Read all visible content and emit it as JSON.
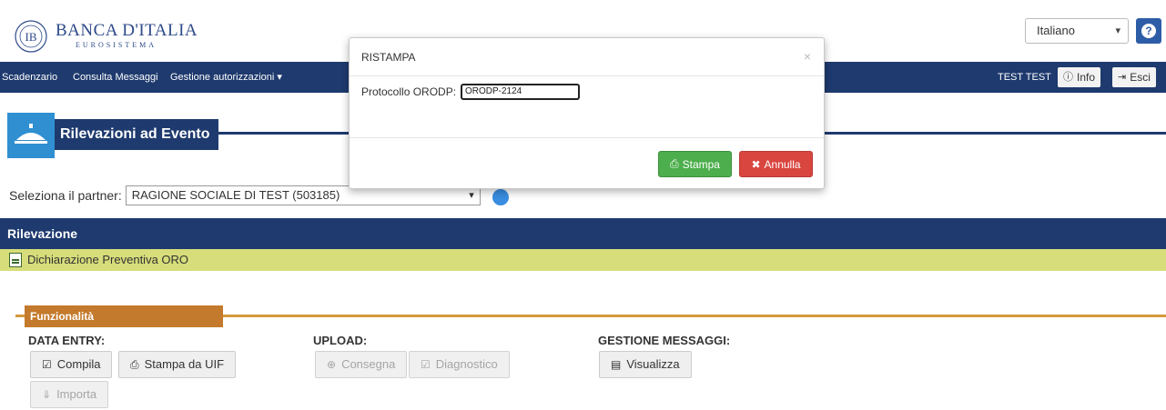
{
  "header": {
    "logo_name": "BANCA D'ITALIA",
    "logo_sub": "EUROSISTEMA",
    "language": "Italiano",
    "help_label": "?"
  },
  "nav": {
    "items": [
      "Scadenzario",
      "Consulta Messaggi",
      "Gestione autorizzazioni ▾"
    ],
    "user": "TEST TEST",
    "info_label": "Info",
    "exit_label": "Esci"
  },
  "page": {
    "section_title": "Rilevazioni ad Evento",
    "partner_label": "Seleziona il partner:",
    "partner_value": "RAGIONE SOCIALE DI TEST (503185)",
    "rilevazione_label": "Rilevazione",
    "dichiarazione_label": "Dichiarazione Preventiva ORO",
    "funzionalita_label": "Funzionalità",
    "groups": {
      "data_entry": "DATA ENTRY:",
      "upload": "UPLOAD:",
      "gestione": "GESTIONE MESSAGGI:"
    },
    "buttons": {
      "compila": "Compila",
      "stampa_uif": "Stampa da UIF",
      "importa": "Importa",
      "consegna": "Consegna",
      "diagnostico": "Diagnostico",
      "visualizza": "Visualizza"
    }
  },
  "modal": {
    "title": "RISTAMPA",
    "close": "×",
    "protocol_label": "Protocollo ORODP:",
    "protocol_value": "ORODP-2124",
    "stampa_label": "Stampa",
    "annulla_label": "Annulla"
  },
  "colors": {
    "navy": "#1e3a6e",
    "green": "#4cae4c",
    "red": "#d9453f",
    "orange": "#c47a2c",
    "yellow": "#d7dd7a"
  }
}
